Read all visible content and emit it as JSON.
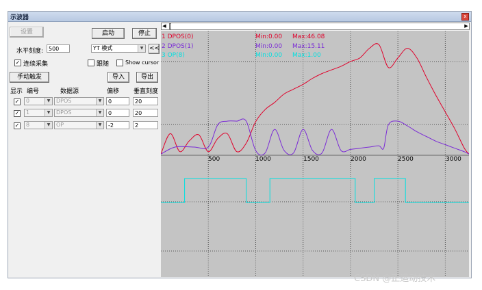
{
  "window": {
    "title": "示波器",
    "close_glyph": "x"
  },
  "toolbar": {
    "settings_label": "设置",
    "start_label": "启动",
    "stop_label": "停止"
  },
  "horizontal": {
    "label": "水平刻度:",
    "value": "500",
    "mode_value": "YT 模式",
    "collapse_label": "<<"
  },
  "options": {
    "continuous_label": "连续采集",
    "continuous_checked": true,
    "follow_label": "跟随",
    "follow_checked": false,
    "cursor_label": "Show cursor",
    "cursor_checked": false
  },
  "actions": {
    "manual_trigger_label": "手动触发",
    "import_label": "导入",
    "export_label": "导出"
  },
  "table": {
    "headers": [
      "显示",
      "编号",
      "数据源",
      "偏移",
      "垂直刻度"
    ],
    "rows": [
      {
        "show": true,
        "index": "0",
        "source": "DPOS",
        "offset": "0",
        "scale": "20"
      },
      {
        "show": true,
        "index": "1",
        "source": "DPOS",
        "offset": "0",
        "scale": "20"
      },
      {
        "show": true,
        "index": "8",
        "source": "OP",
        "offset": "-2",
        "scale": "2"
      }
    ]
  },
  "legend": [
    {
      "name": "1 DPOS(0)",
      "min": "Min:0.00",
      "max": "Max:46.08",
      "color": "#e0002a"
    },
    {
      "name": "2 DPOS(1)",
      "min": "Min:0.00",
      "max": "Max:15.11",
      "color": "#7a2ad6"
    },
    {
      "name": "3 OP(8)",
      "min": "Min:0.00",
      "max": "Max:1.00",
      "color": "#00e0e0"
    }
  ],
  "x_ticks": [
    "500",
    "1000",
    "1500",
    "2000",
    "2500",
    "3000"
  ],
  "watermark": "CSDN @正运动技术",
  "chart_data": {
    "type": "line",
    "xlim": [
      0,
      3250
    ],
    "x_ticks": [
      500,
      1000,
      1500,
      2000,
      2500,
      3000
    ],
    "grid": true,
    "series": [
      {
        "name": "1 DPOS(0)",
        "color": "#e0002a",
        "x": [
          0,
          100,
          200,
          300,
          400,
          500,
          600,
          700,
          800,
          900,
          1000,
          1100,
          1200,
          1300,
          1400,
          1500,
          1600,
          1700,
          1800,
          1900,
          2000,
          2100,
          2200,
          2300,
          2400,
          2500,
          2600,
          2700,
          2800,
          2900,
          3000,
          3100,
          3200,
          3250
        ],
        "y": [
          0.5,
          9.0,
          1.5,
          6.0,
          8.5,
          1.5,
          7.0,
          9.0,
          1.5,
          5.0,
          14.0,
          19.0,
          22.0,
          25.5,
          27.5,
          29.5,
          32.0,
          34.0,
          35.5,
          37.0,
          39.0,
          40.5,
          44.5,
          46.0,
          36.5,
          40.5,
          44.5,
          40.5,
          32.5,
          25.0,
          18.0,
          11.0,
          3.0,
          0.5
        ]
      },
      {
        "name": "2 DPOS(1)",
        "color": "#7a2ad6",
        "x": [
          0,
          150,
          350,
          500,
          600,
          700,
          800,
          900,
          1000,
          1100,
          1200,
          1300,
          1400,
          1500,
          1600,
          1700,
          1800,
          1900,
          2000,
          2100,
          2200,
          2300,
          2350,
          2400,
          2500,
          2600,
          2700,
          2800,
          2900,
          3000,
          3100,
          3200,
          3250
        ],
        "y": [
          0.5,
          3.5,
          3.5,
          3.5,
          13.0,
          14.5,
          14.5,
          14.5,
          2.0,
          1.0,
          11.0,
          2.0,
          1.0,
          11.0,
          2.0,
          1.0,
          11.0,
          2.0,
          2.5,
          3.0,
          3.5,
          4.0,
          3.0,
          13.0,
          14.5,
          12.5,
          10.0,
          8.0,
          6.0,
          4.5,
          3.0,
          1.5,
          0.5
        ]
      },
      {
        "name": "3 OP(8)",
        "color": "#00e0e0",
        "x": [
          0,
          250,
          250,
          900,
          900,
          1150,
          1150,
          2050,
          2050,
          2250,
          2250,
          2580,
          2580,
          3250
        ],
        "y": [
          0,
          0,
          1,
          1,
          0,
          0,
          1,
          1,
          0,
          0,
          1,
          1,
          0,
          0
        ]
      }
    ]
  }
}
